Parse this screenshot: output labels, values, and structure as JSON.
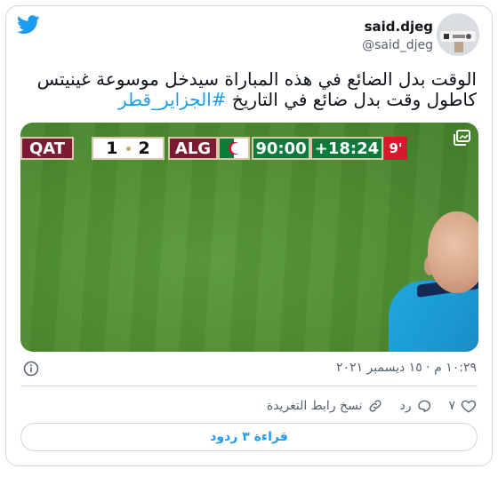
{
  "author": {
    "display_name": "said.djeg",
    "handle": "@said_djeg"
  },
  "tweet": {
    "line1": "الوقت بدل الضائع في هذه المباراة سيدخل موسوعة غينيتس",
    "line2_text": "كاطول وقت بدل ضائع في التاريخ ",
    "hashtag": "#الجزاير_قطر"
  },
  "scoreboard": {
    "home": "QAT",
    "home_score": "1",
    "away_score": "2",
    "away": "ALG",
    "clock": "90:00",
    "added": "+18:24",
    "added_minutes": "9'"
  },
  "meta": {
    "timestamp": "١٠:٢٩ م · ١٥ ديسمبر ٢٠٢١"
  },
  "actions": {
    "like_count": "٧",
    "reply_label": "رد",
    "copy_link_label": "نسخ رابط التغريدة"
  },
  "read_replies_label": "قراءة ٣ ردود",
  "colors": {
    "twitter_blue": "#1d9bf0",
    "scoreboard_maroon": "#7d1a33",
    "scoreboard_green": "#0b7a3a",
    "scoreboard_red": "#d8192d"
  },
  "icons": [
    "twitter-bird-icon",
    "gallery-icon",
    "info-icon",
    "heart-icon",
    "reply-icon",
    "link-icon"
  ]
}
